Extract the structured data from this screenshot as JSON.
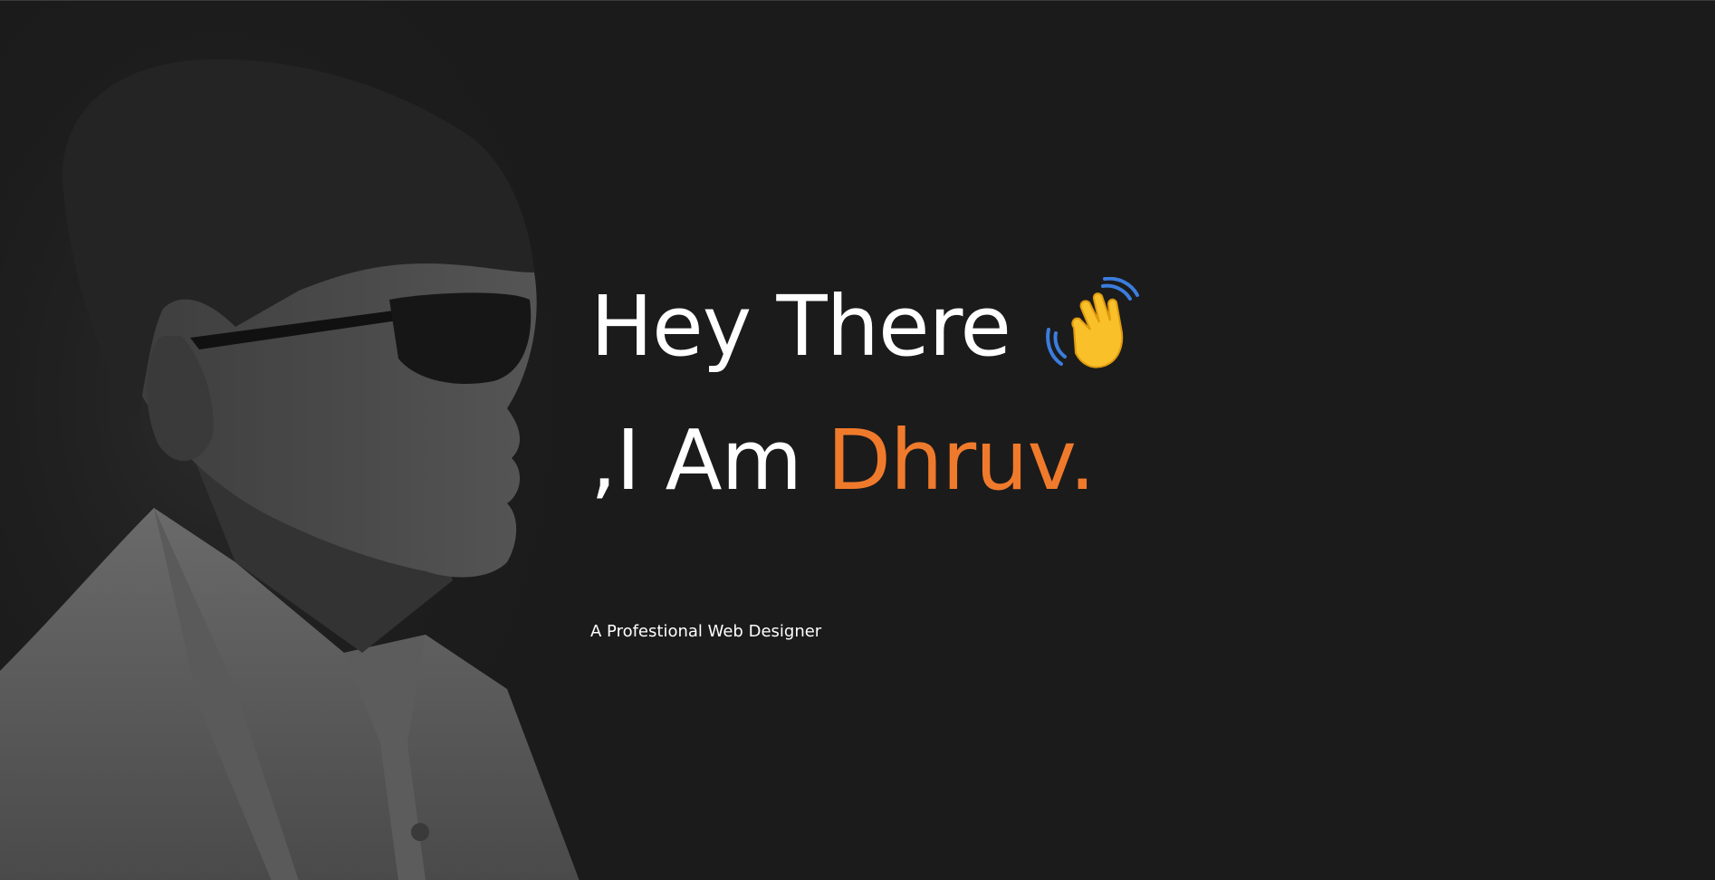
{
  "hero": {
    "greeting": "Hey There",
    "intro_prefix": ",I Am",
    "name": "Dhruv.",
    "subtitle": "A Profestional Web Designer",
    "wave_icon": "waving-hand-icon"
  },
  "portrait": {
    "icon": "portrait-photo"
  },
  "colors": {
    "background": "#1b1b1b",
    "text": "#ffffff",
    "accent": "#f07a2c",
    "wave_hand": "#f9c02a",
    "wave_lines": "#3b7ddd"
  }
}
